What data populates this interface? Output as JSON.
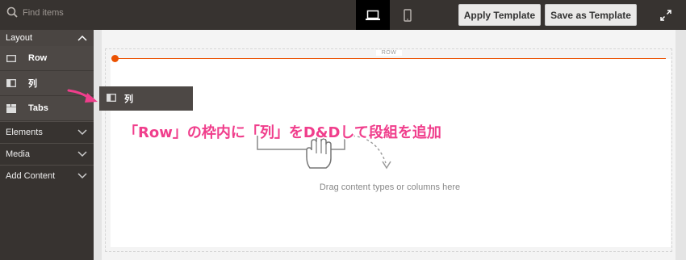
{
  "search": {
    "placeholder": "Find items"
  },
  "toolbar": {
    "apply_label": "Apply Template",
    "save_label": "Save as Template",
    "devices": [
      "desktop-icon",
      "mobile-icon"
    ],
    "fullscreen_icon": "fullscreen-icon"
  },
  "sidebar": {
    "layout": {
      "label": "Layout",
      "expanded": true,
      "items": [
        {
          "label": "Row",
          "icon": "row-icon"
        },
        {
          "label": "列",
          "icon": "column-icon"
        },
        {
          "label": "Tabs",
          "icon": "tabs-icon"
        }
      ]
    },
    "sections": [
      {
        "label": "Elements"
      },
      {
        "label": "Media"
      },
      {
        "label": "Add Content"
      }
    ]
  },
  "stage": {
    "row_label": "ROW",
    "drop_hint": "Drag content types or columns here",
    "dragging_item": {
      "label": "列",
      "icon": "column-icon"
    }
  },
  "annotation": {
    "text": "「Row」の枠内に「列」をD&Dして段組を追加",
    "color": "#f03e8c"
  },
  "colors": {
    "accent": "#eb5202",
    "panel": "#373330",
    "panel_item": "#4d4845"
  }
}
